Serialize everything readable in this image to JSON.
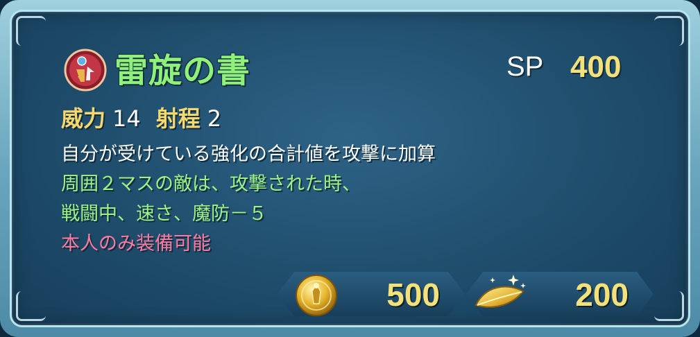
{
  "skill": {
    "name": "雷旋の書",
    "sp_label": "SP",
    "sp_value": "400",
    "icon": "weapon-skill-icon"
  },
  "stats": {
    "might_label": "威力",
    "might_value": "14",
    "range_label": "射程",
    "range_value": "2"
  },
  "description": {
    "line1": "自分が受けている強化の合計値を攻撃に加算",
    "line2": "周囲２マスの敵は、攻撃された時、",
    "line3": "戦闘中、速さ、魔防－５",
    "restriction": "本人のみ装備可能"
  },
  "costs": {
    "coin_icon": "gold-coin-icon",
    "coin_value": "500",
    "feather_icon": "golden-leaf-icon",
    "feather_value": "200"
  },
  "colors": {
    "name": "#8ff07a",
    "stat_label": "#f5d86e",
    "effect_text": "#9cf384",
    "restriction": "#ff7aa0",
    "value_gold": "#f5e17a"
  }
}
